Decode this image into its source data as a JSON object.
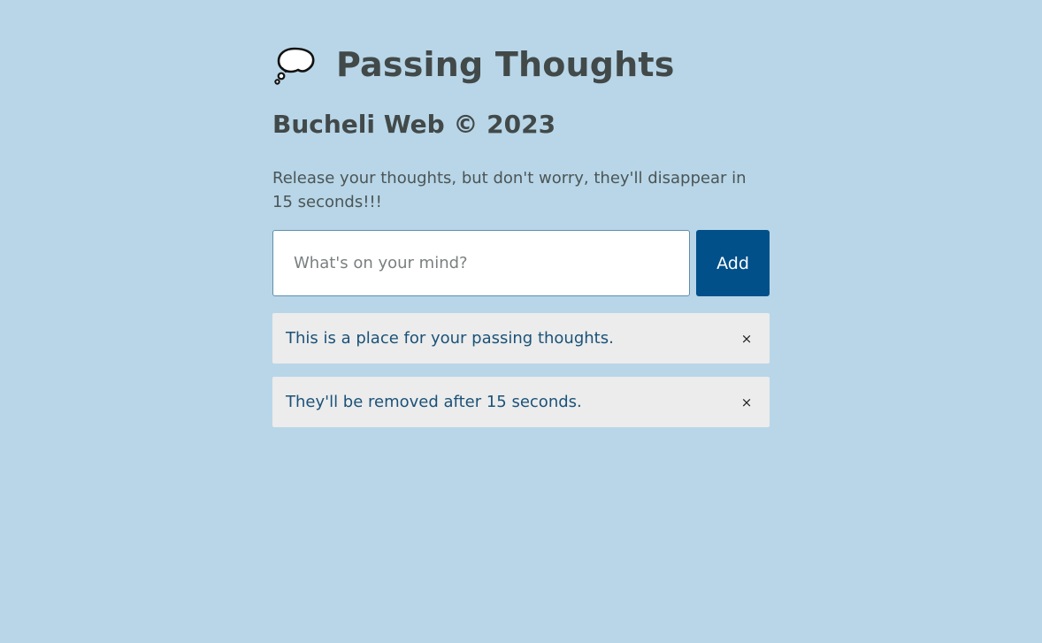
{
  "header": {
    "icon": "thought-balloon-icon",
    "title": "Passing Thoughts",
    "subtitle": "Bucheli Web © 2023",
    "description": "Release your thoughts, but don't worry, they'll disappear in 15 seconds!!!"
  },
  "form": {
    "input_value": "",
    "input_placeholder": "What's on your mind?",
    "add_label": "Add"
  },
  "thoughts": [
    {
      "text": "This is a place for your passing thoughts.",
      "remove_label": "×"
    },
    {
      "text": "They'll be removed after 15 seconds.",
      "remove_label": "×"
    }
  ],
  "colors": {
    "background": "#b8d6e8",
    "accent": "#02508a",
    "heading": "#424949",
    "thought_text": "#1b5278",
    "thought_bg": "#ececec"
  }
}
